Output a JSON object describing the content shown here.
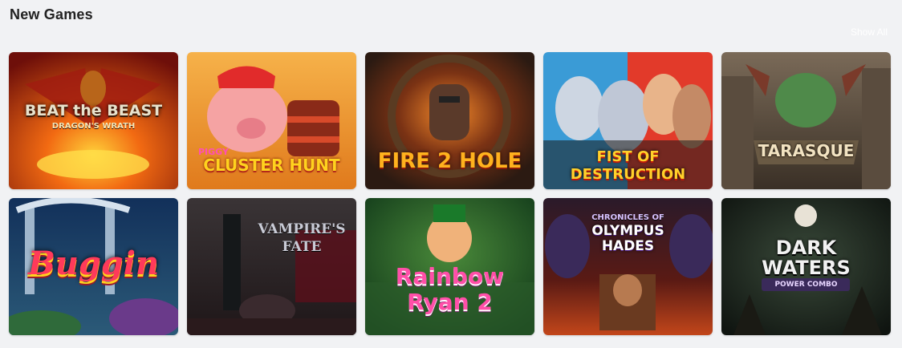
{
  "section": {
    "title": "New Games",
    "show_all_label": "Show All"
  },
  "games": [
    {
      "title": "BEAT the BEAST",
      "subtitle": "DRAGON'S WRATH"
    },
    {
      "title": "CLUSTER HUNT",
      "subtitle": "PIGGY"
    },
    {
      "title": "FIRE 2 HOLE",
      "subtitle": ""
    },
    {
      "title": "FIST OF DESTRUCTION",
      "subtitle": ""
    },
    {
      "title": "TARASQUE",
      "subtitle": ""
    },
    {
      "title": "Buggin",
      "subtitle": ""
    },
    {
      "title": "VAMPIRE'S FATE",
      "subtitle": ""
    },
    {
      "title": "Rainbow Ryan 2",
      "subtitle": ""
    },
    {
      "title": "OLYMPUS HADES",
      "subtitle": "CHRONICLES OF"
    },
    {
      "title": "DARK WATERS",
      "subtitle": "POWER COMBO"
    }
  ],
  "colors": {
    "page_bg": "#f1f2f4",
    "title": "#222222"
  }
}
